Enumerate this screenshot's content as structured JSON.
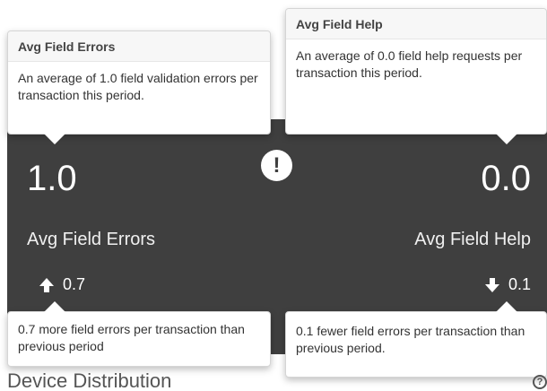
{
  "metrics": {
    "left": {
      "value": "1.0",
      "label": "Avg Field Errors",
      "delta": "0.7",
      "direction": "up"
    },
    "right": {
      "value": "0.0",
      "label": "Avg Field Help",
      "delta": "0.1",
      "direction": "down"
    }
  },
  "alert_icon": "exclamation-icon",
  "popovers": {
    "errors": {
      "title": "Avg Field Errors",
      "body": "An average of 1.0 field validation errors per transaction this period."
    },
    "help": {
      "title": "Avg Field Help",
      "body": "An average of 0.0 field help requests per transaction this period."
    },
    "errors_delta": {
      "body": "0.7 more field errors per transaction than previous period"
    },
    "help_delta": {
      "body": "0.1 fewer field errors per transaction than previous period."
    }
  },
  "section": {
    "title": "Device Distribution",
    "help_icon": "?"
  },
  "colors": {
    "panel": "#3f3f3f",
    "text_light": "#ffffff"
  }
}
